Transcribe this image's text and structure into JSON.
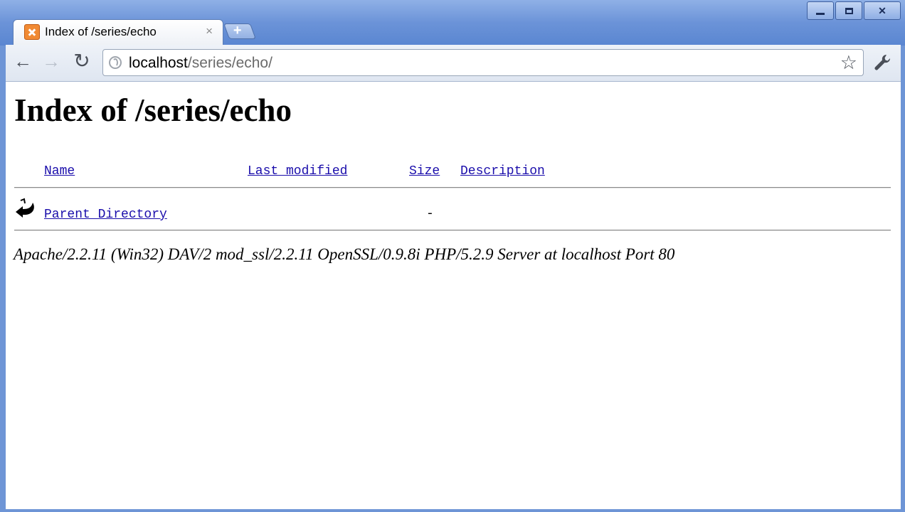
{
  "window": {
    "controls": [
      "minimize",
      "maximize",
      "close"
    ],
    "close_glyph": "✕"
  },
  "tab": {
    "title": "Index of /series/echo",
    "close_glyph": "×",
    "favicon": "xampp-icon"
  },
  "newtab": {
    "glyph": "+"
  },
  "toolbar": {
    "back_glyph": "←",
    "forward_glyph": "→",
    "reload_glyph": "↻",
    "url_host": "localhost",
    "url_path": "/series/echo/",
    "star_glyph": "☆"
  },
  "page": {
    "heading": "Index of /series/echo",
    "columns": {
      "name": "Name",
      "last_modified": "Last modified",
      "size": "Size",
      "description": "Description"
    },
    "rows": [
      {
        "name": "Parent Directory",
        "last_modified": "",
        "size": "-",
        "description": "",
        "icon": "back-arrow-icon"
      }
    ],
    "address": "Apache/2.2.11 (Win32) DAV/2 mod_ssl/2.2.11 OpenSSL/0.9.8i PHP/5.2.9 Server at localhost Port 80"
  }
}
